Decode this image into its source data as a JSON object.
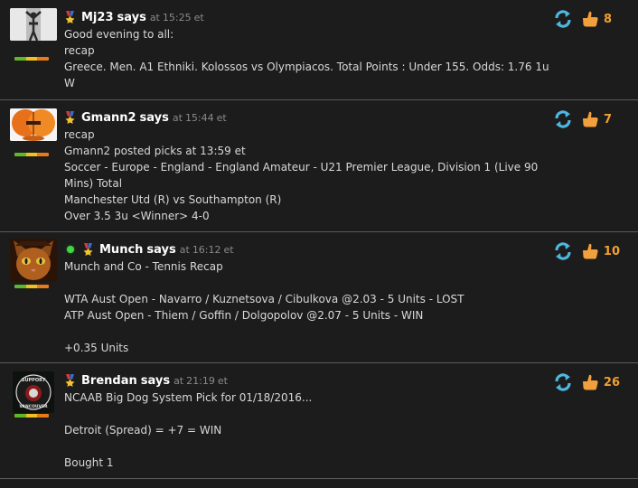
{
  "comments": [
    {
      "author": "Mj23",
      "says": "says",
      "at": "at",
      "time": "15:25",
      "tz": "et",
      "likes": "8",
      "lines": [
        "Good evening to all:",
        "recap",
        "Greece. Men. A1 Ethniki. Kolossos vs Olympiacos. Total Points : Under 155. Odds: 1.76 1u",
        "W"
      ]
    },
    {
      "author": "Gmann2",
      "says": "says",
      "at": "at",
      "time": "15:44",
      "tz": "et",
      "likes": "7",
      "lines": [
        "recap",
        "Gmann2 posted picks at 13:59 et",
        "Soccer - Europe - England - England Amateur - U21 Premier League, Division 1 (Live 90",
        "Mins) Total",
        "Manchester Utd (R) vs Southampton (R)",
        "Over 3.5 3u <Winner> 4-0"
      ]
    },
    {
      "author": "Munch",
      "says": "says",
      "at": "at",
      "time": "16:12",
      "tz": "et",
      "likes": "10",
      "lines": [
        "Munch and Co - Tennis Recap",
        "",
        "WTA Aust Open - Navarro / Kuznetsova / Cibulkova @2.03 - 5 Units - LOST",
        "ATP Aust Open - Thiem / Goffin / Dolgopolov @2.07 - 5 Units - WIN",
        "",
        "+0.35 Units"
      ]
    },
    {
      "author": "Brendan",
      "says": "says",
      "at": "at",
      "time": "21:19",
      "tz": "et",
      "likes": "26",
      "avatar_text": "SUPPORT VANCOUVER",
      "lines": [
        "NCAAB Big Dog System Pick for 01/18/2016...",
        "",
        "Detroit (Spread) = +7 = WIN",
        "",
        "Bought 1"
      ]
    }
  ],
  "colors": {
    "background": "#1c1c1c",
    "likes": "#f0a030",
    "retweet": "#4fb8e0",
    "thumb": "#f2a03c",
    "online": "#42d642"
  }
}
